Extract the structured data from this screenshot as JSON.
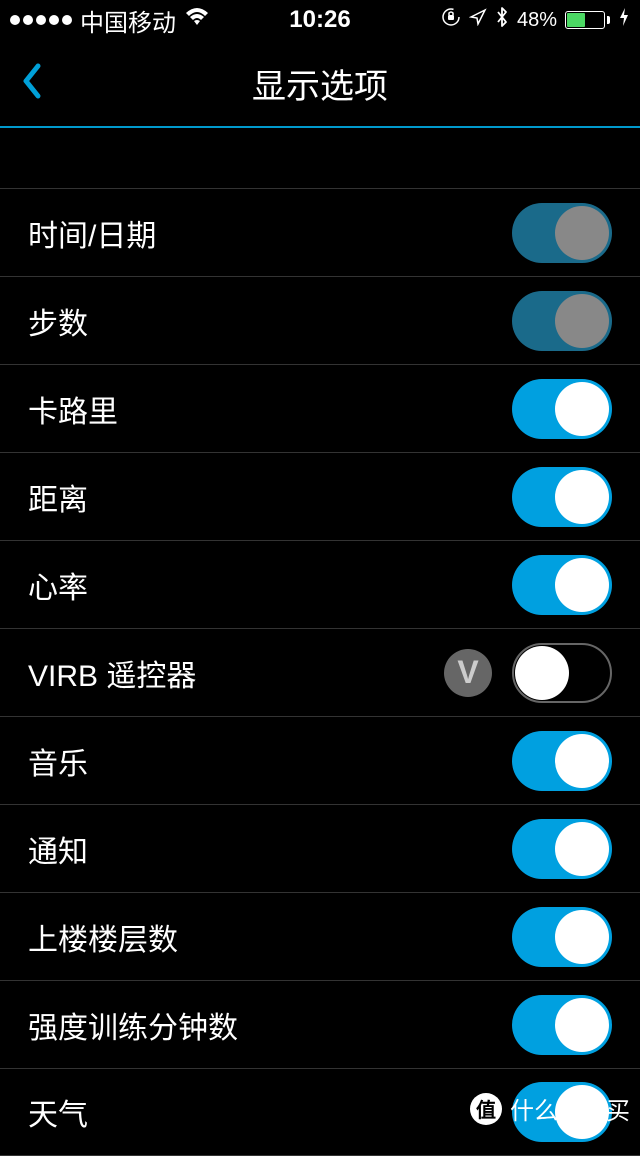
{
  "status_bar": {
    "carrier": "中国移动",
    "time": "10:26",
    "battery_percent": "48%"
  },
  "nav": {
    "title": "显示选项"
  },
  "rows": [
    {
      "label": "时间/日期",
      "toggle": "on-dim",
      "has_v_icon": false
    },
    {
      "label": "步数",
      "toggle": "on-dim",
      "has_v_icon": false
    },
    {
      "label": "卡路里",
      "toggle": "on-blue",
      "has_v_icon": false
    },
    {
      "label": "距离",
      "toggle": "on-blue",
      "has_v_icon": false
    },
    {
      "label": "心率",
      "toggle": "on-blue",
      "has_v_icon": false
    },
    {
      "label": "VIRB 遥控器",
      "toggle": "off",
      "has_v_icon": true
    },
    {
      "label": "音乐",
      "toggle": "on-blue",
      "has_v_icon": false
    },
    {
      "label": "通知",
      "toggle": "on-blue",
      "has_v_icon": false
    },
    {
      "label": "上楼楼层数",
      "toggle": "on-blue",
      "has_v_icon": false
    },
    {
      "label": "强度训练分钟数",
      "toggle": "on-blue",
      "has_v_icon": false
    },
    {
      "label": "天气",
      "toggle": "on-blue",
      "has_v_icon": false
    }
  ],
  "watermark": {
    "icon_text": "值",
    "text": "什么值得买"
  }
}
